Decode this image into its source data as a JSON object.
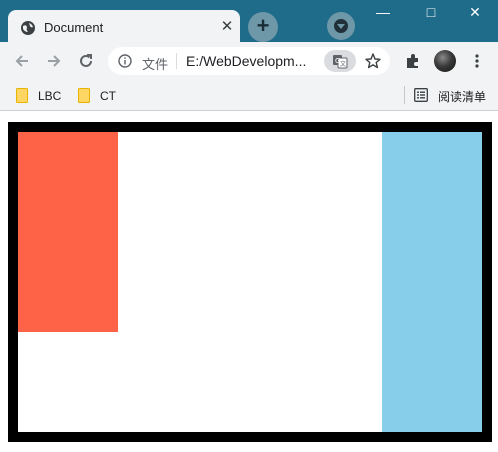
{
  "browser": {
    "tab": {
      "title": "Document",
      "close_icon": "close-icon",
      "favicon": "globe-icon"
    },
    "window_controls": {
      "minimize": "—",
      "maximize": "□",
      "close": "✕"
    },
    "toolbar": {
      "scheme_label": "文件",
      "url": "E:/WebDevelopm...",
      "icons": [
        "back-arrow-icon",
        "forward-arrow-icon",
        "reload-icon",
        "info-icon",
        "translate-icon",
        "star-icon",
        "extensions-icon",
        "avatar",
        "menu-icon"
      ]
    },
    "bookmarks": {
      "items": [
        {
          "label": "LBC"
        },
        {
          "label": "CT"
        }
      ],
      "reading_list_label": "阅读清单"
    }
  },
  "page": {
    "frame_border_color": "#000000",
    "background": "#ffffff",
    "boxes": [
      {
        "name": "red-box",
        "color": "#ff6347"
      },
      {
        "name": "blue-box",
        "color": "#87ceeb"
      }
    ]
  }
}
